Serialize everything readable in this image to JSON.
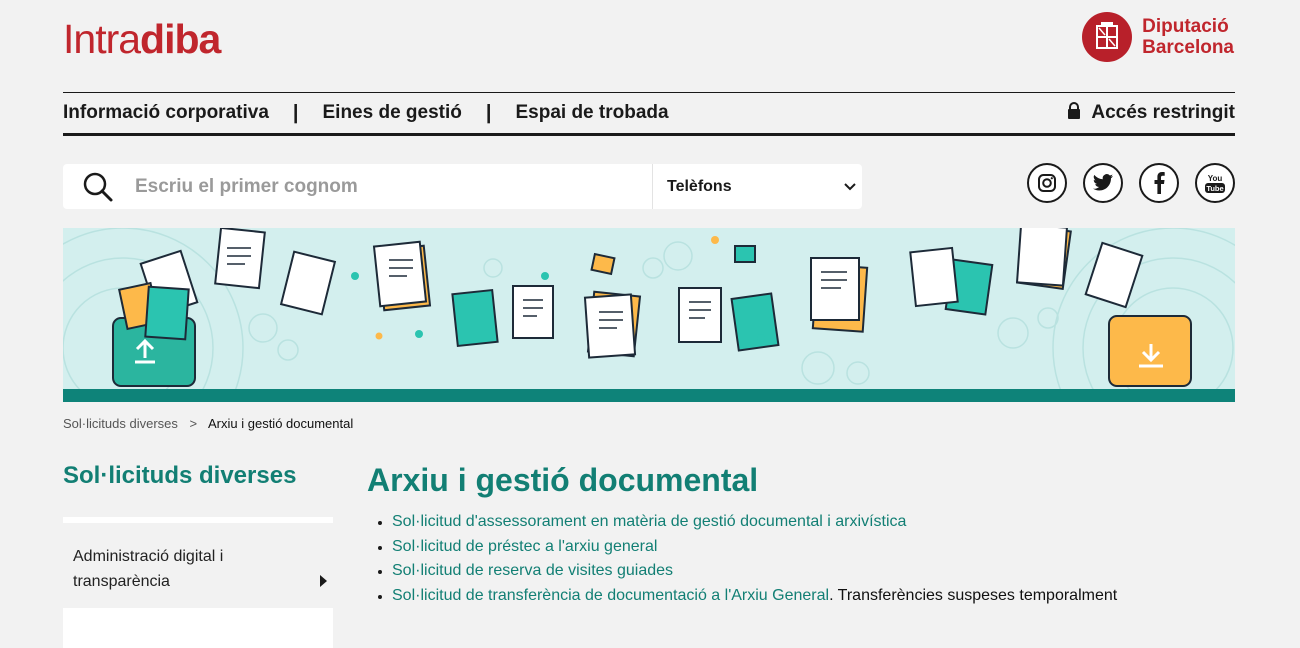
{
  "header": {
    "logo_light": "Intra",
    "logo_bold": "diba",
    "org_line1": "Diputació",
    "org_line2": "Barcelona"
  },
  "nav": {
    "items": [
      "Informació corporativa",
      "Eines de gestió",
      "Espai de trobada"
    ],
    "separator": "|",
    "restricted": "Accés restringit"
  },
  "search": {
    "placeholder": "Escriu el primer cognom",
    "select_value": "Telèfons"
  },
  "social": [
    "instagram-icon",
    "twitter-icon",
    "facebook-icon",
    "youtube-icon"
  ],
  "breadcrumb": {
    "parent": "Sol·licituds diverses",
    "separator": ">",
    "current": "Arxiu i gestió documental"
  },
  "sidebar": {
    "title": "Sol·licituds diverses",
    "items": [
      {
        "label": "Administració digital i transparència"
      }
    ]
  },
  "main": {
    "title": "Arxiu i gestió documental",
    "links": [
      "Sol·licitud d'assessorament en matèria de gestió documental i arxivística",
      "Sol·licitud de préstec a l'arxiu general",
      "Sol·licitud de reserva de visites guiades",
      "Sol·licitud de transferència de documentació a l'Arxiu General"
    ],
    "note": ". Transferències suspeses temporalment"
  },
  "colors": {
    "brand_red": "#c0262d",
    "accent_teal": "#127f74",
    "banner_bg": "#d3efee"
  }
}
